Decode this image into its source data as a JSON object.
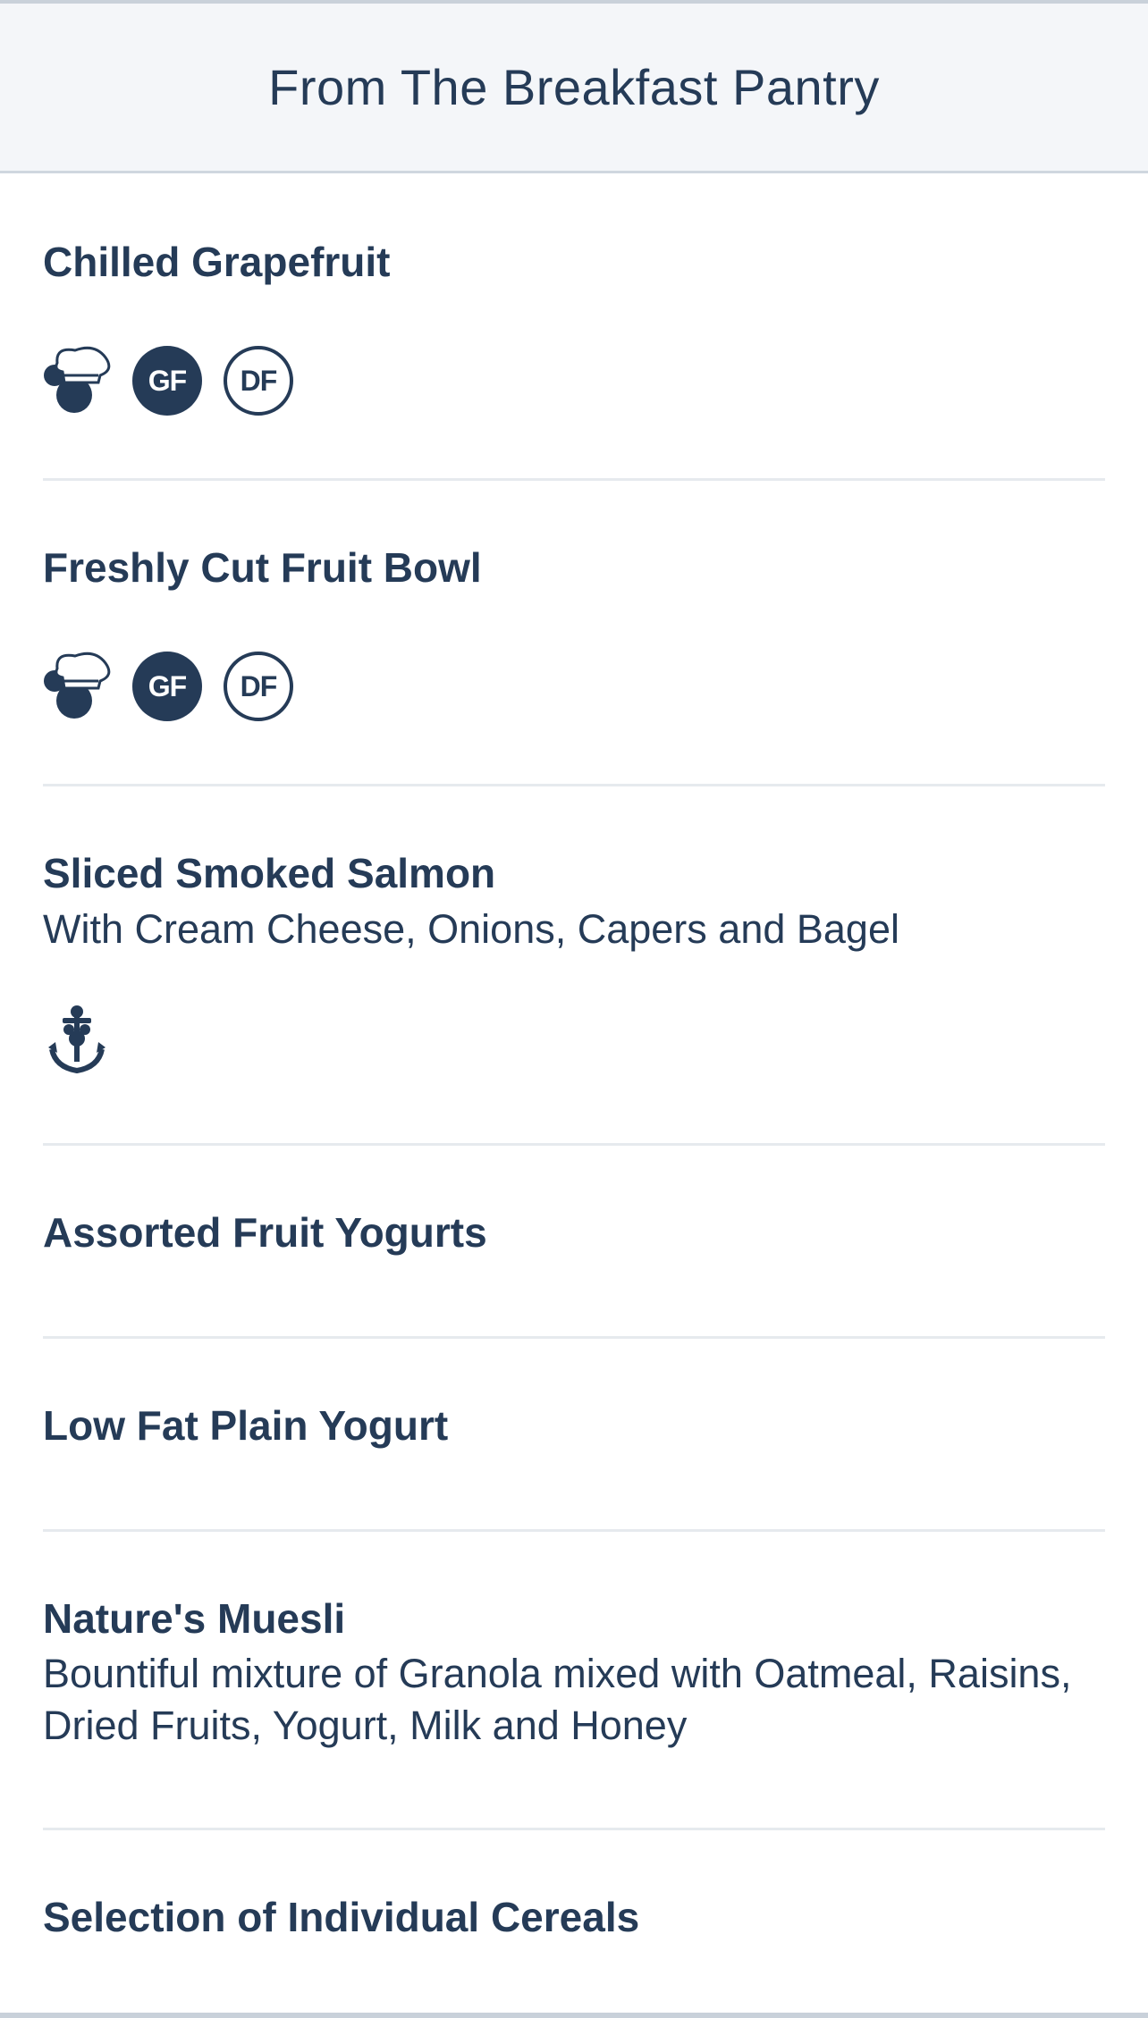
{
  "header": {
    "title": "From The Breakfast Pantry"
  },
  "items": [
    {
      "name": "Chilled Grapefruit",
      "icons": [
        "chef-mickey-icon",
        "gluten-free-badge",
        "dairy-free-badge"
      ],
      "badges": {
        "gf": "GF",
        "df": "DF"
      }
    },
    {
      "name": "Freshly Cut Fruit Bowl",
      "icons": [
        "chef-mickey-icon",
        "gluten-free-badge",
        "dairy-free-badge"
      ],
      "badges": {
        "gf": "GF",
        "df": "DF"
      }
    },
    {
      "name": "Sliced Smoked Salmon",
      "description": "With Cream Cheese, Onions, Capers and Bagel",
      "icons": [
        "mickey-anchor-icon"
      ]
    },
    {
      "name": "Assorted Fruit Yogurts"
    },
    {
      "name": "Low Fat Plain Yogurt"
    },
    {
      "name": "Nature's Muesli",
      "description": "Bountiful mixture of Granola mixed with Oatmeal, Raisins, Dried Fruits, Yogurt, Milk and Honey"
    },
    {
      "name": "Selection of Individual Cereals"
    }
  ],
  "colors": {
    "text": "#253b57",
    "header_bg": "#f4f6f9",
    "divider": "#e6eaee",
    "badge_fill": "#253b57"
  }
}
